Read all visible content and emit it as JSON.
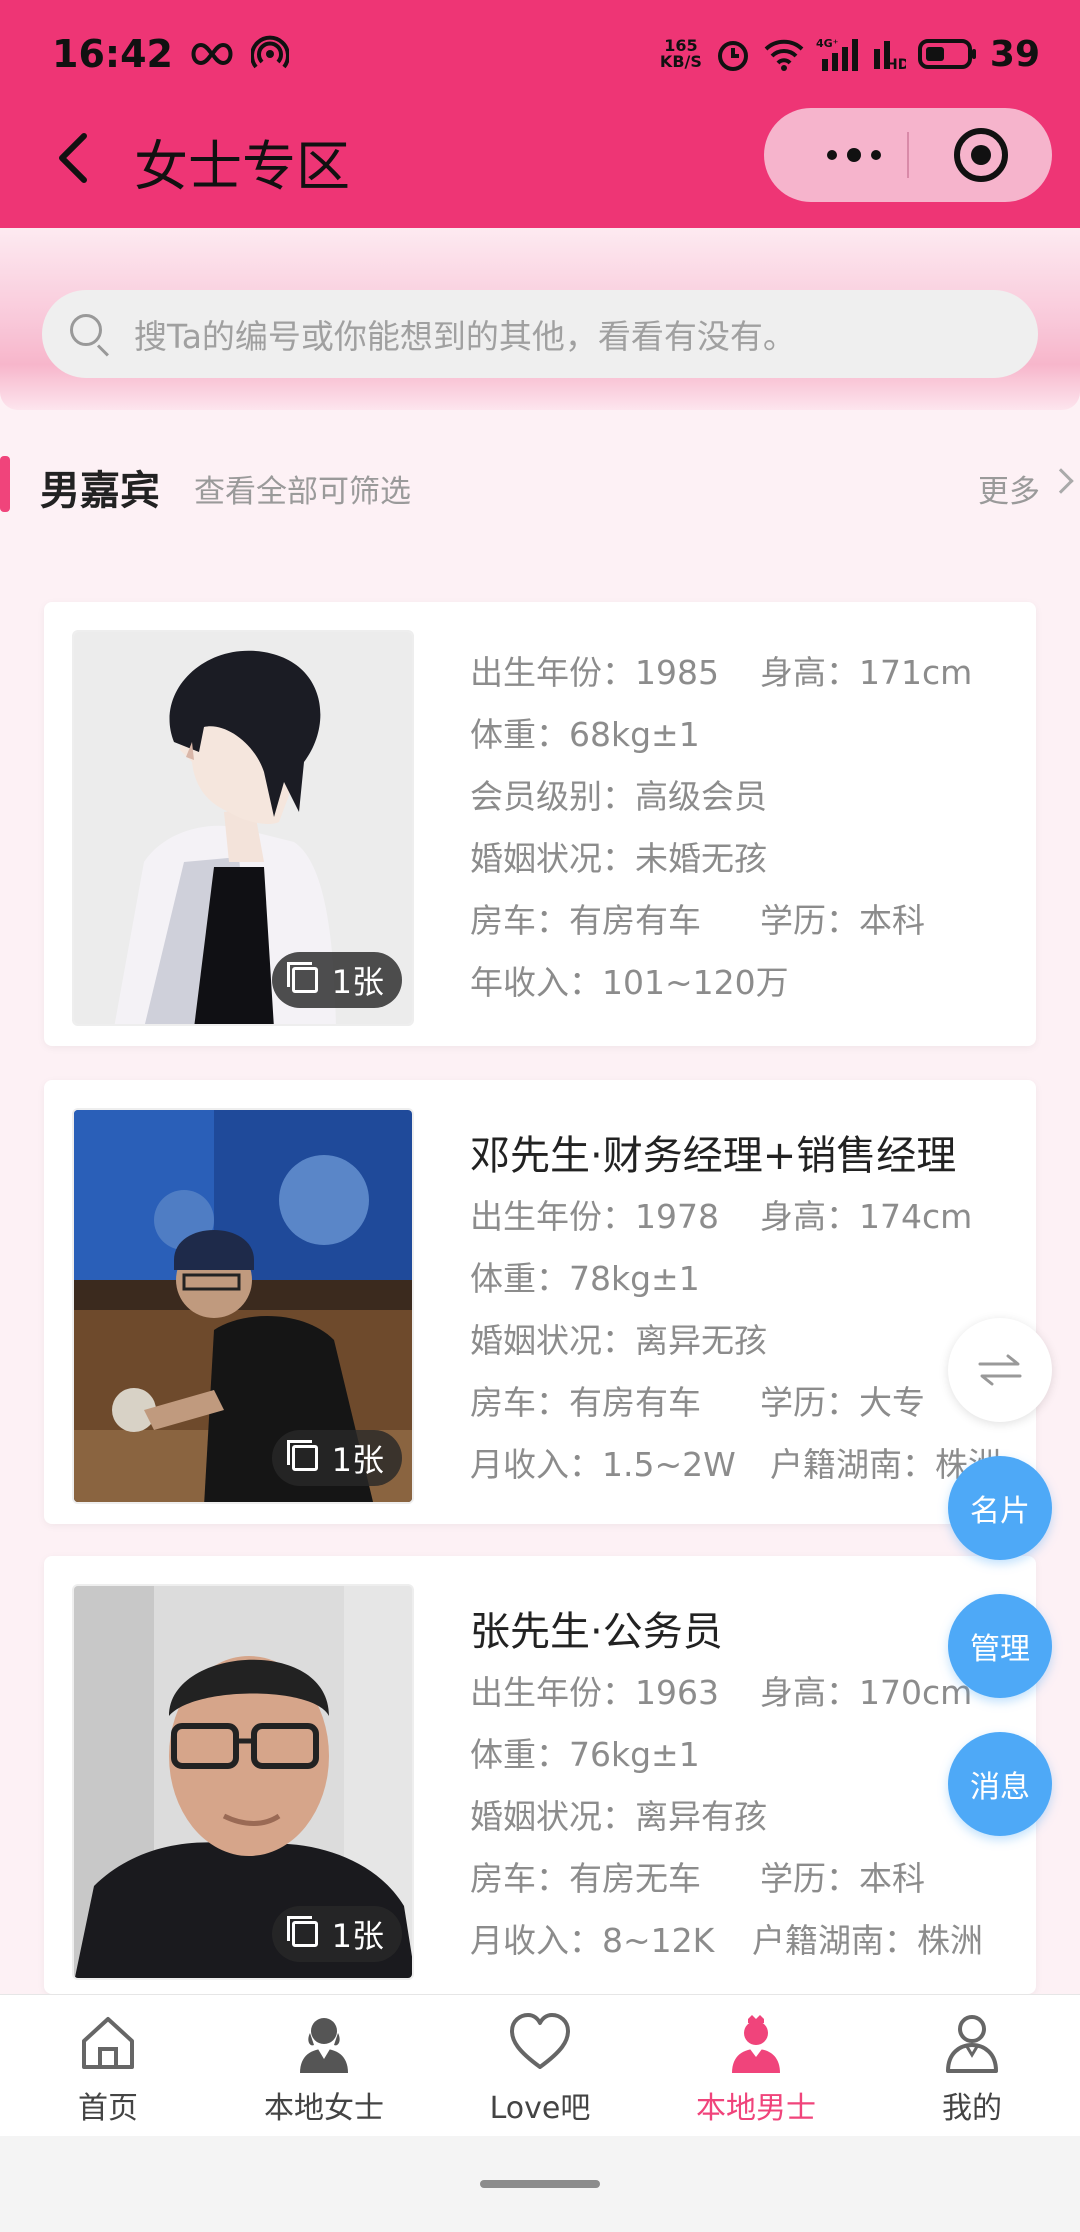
{
  "status_bar": {
    "time": "16:42",
    "net_speed_value": "165",
    "net_speed_unit": "KB/S",
    "network": "4G",
    "hd": "HD",
    "battery": "39"
  },
  "nav": {
    "title": "女士专区"
  },
  "search": {
    "placeholder": "搜Ta的编号或你能想到的其他，看看有没有。"
  },
  "section": {
    "title": "男嘉宾",
    "subtitle": "查看全部可筛选",
    "more": "更多"
  },
  "cards": [
    {
      "name": "",
      "photo_count": "1张",
      "rows": [
        {
          "a": "出生年份：1985",
          "b": "身高：171cm"
        },
        {
          "a": "体重：68kg±1",
          "b": ""
        },
        {
          "a": "会员级别：高级会员",
          "b": ""
        },
        {
          "a": "婚姻状况：未婚无孩",
          "b": ""
        },
        {
          "a": "房车：有房有车",
          "b": "学历：本科"
        },
        {
          "a": "年收入：101~120万",
          "b": ""
        }
      ]
    },
    {
      "name": "邓先生·财务经理+销售经理",
      "photo_count": "1张",
      "rows": [
        {
          "a": "出生年份：1978",
          "b": "身高：174cm"
        },
        {
          "a": "体重：78kg±1",
          "b": ""
        },
        {
          "a": "婚姻状况：离异无孩",
          "b": ""
        },
        {
          "a": "房车：有房有车",
          "b": "学历：大专"
        },
        {
          "a": "月收入：1.5~2W",
          "b": "户籍湖南：株洲"
        }
      ]
    },
    {
      "name": "张先生·公务员",
      "photo_count": "1张",
      "rows": [
        {
          "a": "出生年份：1963",
          "b": "身高：170cm"
        },
        {
          "a": "体重：76kg±1",
          "b": ""
        },
        {
          "a": "婚姻状况：离异有孩",
          "b": ""
        },
        {
          "a": "房车：有房无车",
          "b": "学历：本科"
        },
        {
          "a": "月收入：8~12K",
          "b": "户籍湖南：株洲"
        }
      ]
    }
  ],
  "fabs": {
    "card": "名片",
    "manage": "管理",
    "message": "消息"
  },
  "tabs": [
    {
      "label": "首页",
      "icon": "home-icon",
      "active": false
    },
    {
      "label": "本地女士",
      "icon": "female-user-icon",
      "active": false
    },
    {
      "label": "Love吧",
      "icon": "heart-icon",
      "active": false
    },
    {
      "label": "本地男士",
      "icon": "male-user-icon",
      "active": true
    },
    {
      "label": "我的",
      "icon": "profile-icon",
      "active": false
    }
  ],
  "colors": {
    "brand": "#ee3575",
    "accent": "#f0447b",
    "fab": "#4ea9f7"
  }
}
